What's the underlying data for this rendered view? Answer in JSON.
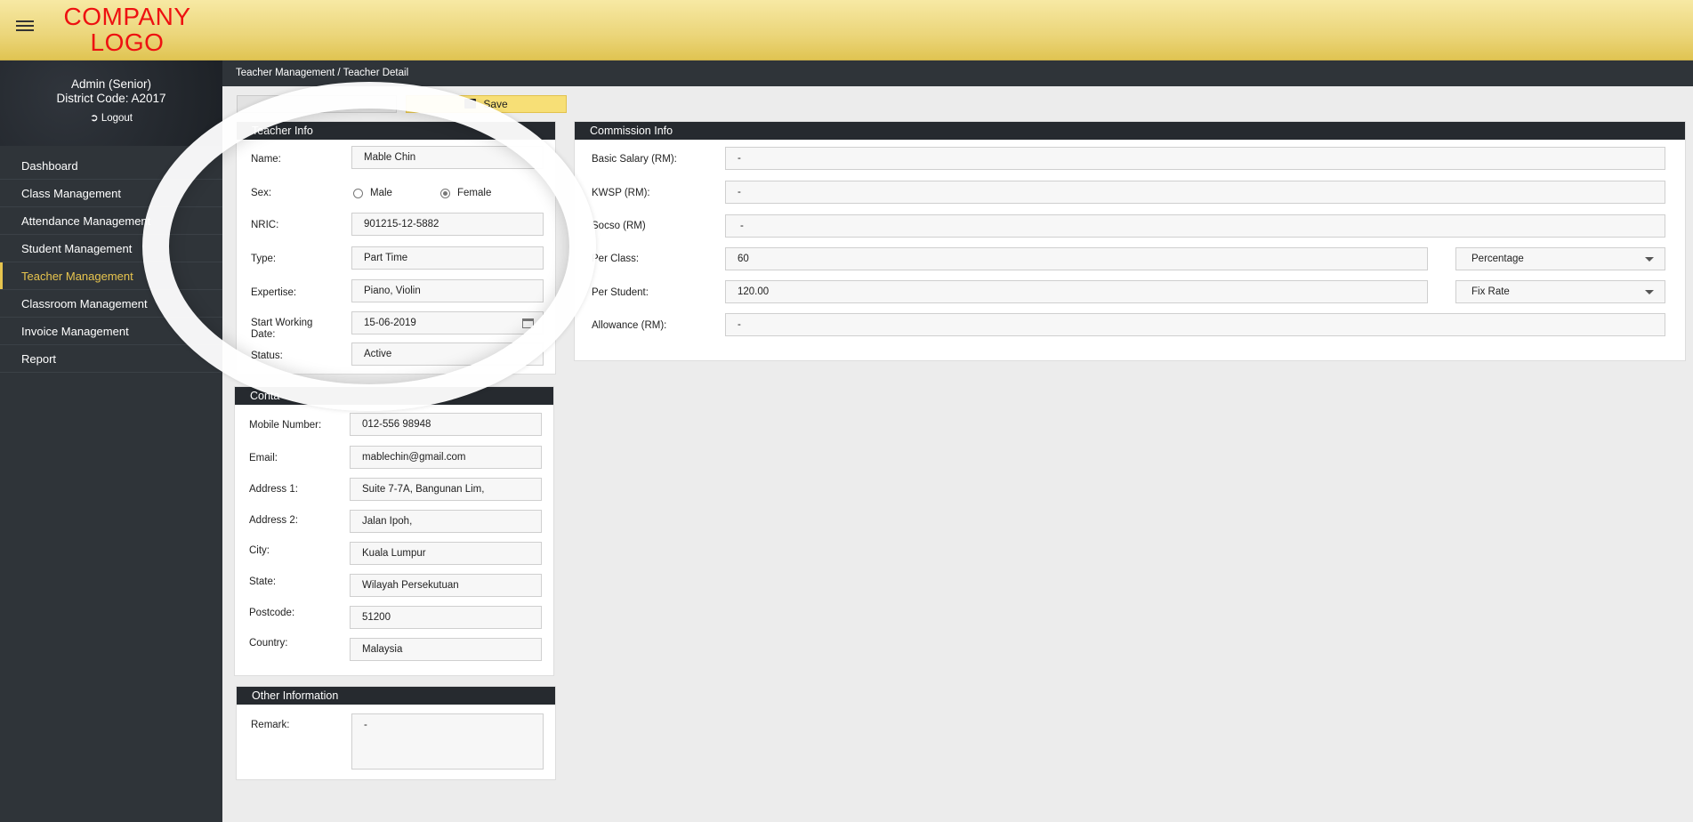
{
  "header": {
    "logo_line1": "COMPANY",
    "logo_line2": "LOGO"
  },
  "sidebar": {
    "user_name": "Admin (Senior)",
    "district_code": "District Code: A2017",
    "logout_label": "Logout",
    "items": [
      {
        "label": "Dashboard"
      },
      {
        "label": "Class Management"
      },
      {
        "label": "Attendance Management"
      },
      {
        "label": "Student Management"
      },
      {
        "label": "Teacher Management"
      },
      {
        "label": "Classroom Management"
      },
      {
        "label": "Invoice Management"
      },
      {
        "label": "Report"
      }
    ],
    "active_index": 4,
    "active_color": "#e7c44e"
  },
  "breadcrumb": "Teacher Management / Teacher Detail",
  "toolbar": {
    "save_label": "Save"
  },
  "teacher_info": {
    "title": "Teacher Info",
    "name_label": "Name:",
    "name_value": "Mable Chin",
    "sex_label": "Sex:",
    "sex_options": [
      "Male",
      "Female"
    ],
    "sex_selected": "Female",
    "nric_label": "NRIC:",
    "nric_value": "901215-12-5882",
    "type_label": "Type:",
    "type_value": "Part Time",
    "expertise_label": "Expertise:",
    "expertise_value": "Piano, Violin",
    "start_label": "Start Working Date:",
    "start_value": "15-06-2019",
    "status_label": "Status:",
    "status_value": "Active"
  },
  "contact_info": {
    "title": "Conta",
    "rows": [
      {
        "label": "Mobile Number:",
        "value": "012-556 98948"
      },
      {
        "label": "Email:",
        "value": "mablechin@gmail.com"
      },
      {
        "label": "Address 1:",
        "value": "Suite 7-7A, Bangunan Lim,"
      },
      {
        "label": "Address 2:",
        "value": "Jalan Ipoh,"
      },
      {
        "label": "City:",
        "value": "Kuala Lumpur"
      },
      {
        "label": "State:",
        "value": "Wilayah Persekutuan"
      },
      {
        "label": "Postcode:",
        "value": "51200"
      },
      {
        "label": "Country:",
        "value": "Malaysia"
      }
    ]
  },
  "other_info": {
    "title": "Other Information",
    "remark_label": "Remark:",
    "remark_value": "-"
  },
  "commission_info": {
    "title": "Commission Info",
    "basic_salary_label": "Basic Salary (RM):",
    "basic_salary_value": "-",
    "kwsp_label": "KWSP (RM):",
    "kwsp_value": "-",
    "socso_label": "Socso (RM)",
    "socso_value": "-",
    "per_class_label": "Per Class:",
    "per_class_value": "60",
    "per_class_mode": "Percentage",
    "per_student_label": "Per Student:",
    "per_student_value": "120.00",
    "per_student_mode": "Fix Rate",
    "allowance_label": "Allowance (RM):",
    "allowance_value": "-"
  }
}
